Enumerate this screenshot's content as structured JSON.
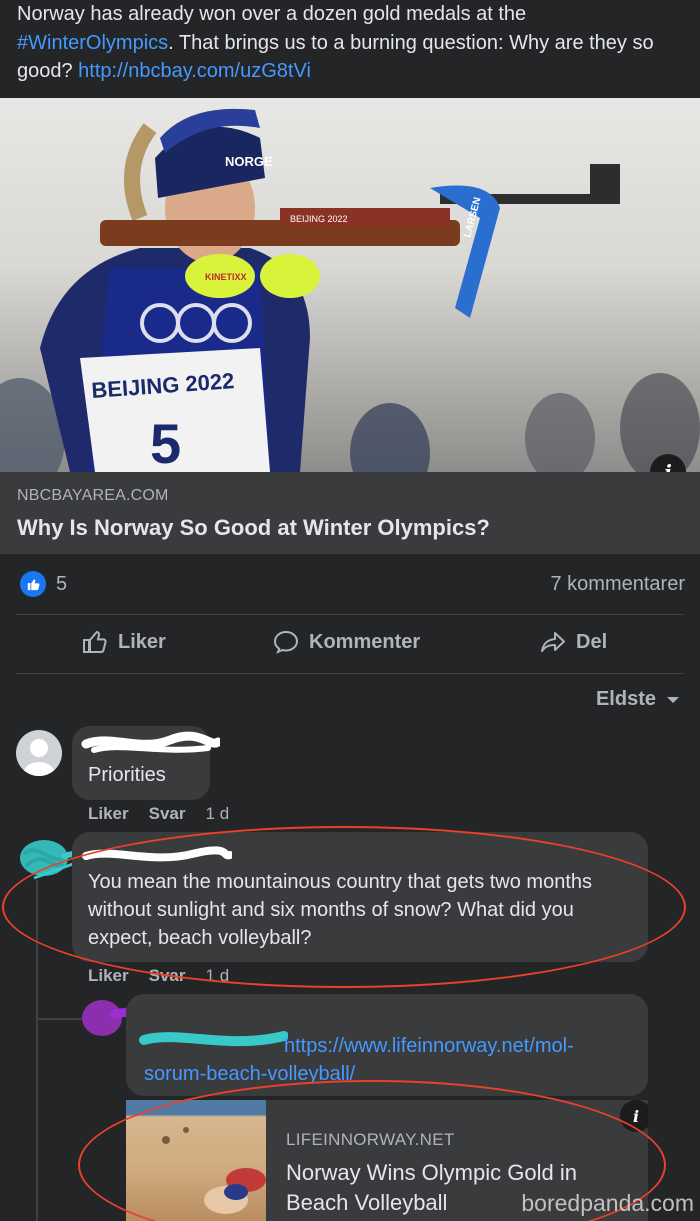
{
  "post": {
    "text_before": "Norway has already won over a dozen gold medals at the ",
    "hashtag": "#WinterOlympics",
    "text_after": ". That brings us to a burning question: Why are they so good? ",
    "url": "http://nbcbay.com/uzG8tVi",
    "photo_bib_text": "BEIJING 2022",
    "photo_bib_number": "5",
    "photo_hat_text": "NORGE",
    "photo_rifle_text": "LARSEN",
    "photo_stock_text": "BEIJING 2022",
    "photo_glove_text": "KINETIXX"
  },
  "link_preview": {
    "domain": "NBCBAYAREA.COM",
    "title": "Why Is Norway So Good at Winter Olympics?",
    "info_icon": "i"
  },
  "reactions": {
    "like_count": "5",
    "comments_count": "7 kommentarer"
  },
  "actions": {
    "like": "Liker",
    "comment": "Kommenter",
    "share": "Del"
  },
  "sort": {
    "label": "Eldste"
  },
  "comments": [
    {
      "text": "Priorities",
      "like": "Liker",
      "reply": "Svar",
      "time": "1 d"
    },
    {
      "text": "You mean the mountainous country that gets two months without sunlight and six months of snow? What did you expect, beach volleyball?",
      "like": "Liker",
      "reply": "Svar",
      "time": "1 d"
    },
    {
      "link": "https://www.lifeinnorway.net/mol-sorum-beach-volleyball/"
    }
  ],
  "mini_preview": {
    "domain": "LIFEINNORWAY.NET",
    "title": "Norway Wins Olympic Gold in Beach Volleyball",
    "info_icon": "i"
  },
  "watermark": "boredpanda.com",
  "colors": {
    "background": "#242526",
    "bubble": "#3a3b3c",
    "link": "#4599ff",
    "annotation_red": "#e8412c",
    "like_blue": "#1877f2"
  }
}
